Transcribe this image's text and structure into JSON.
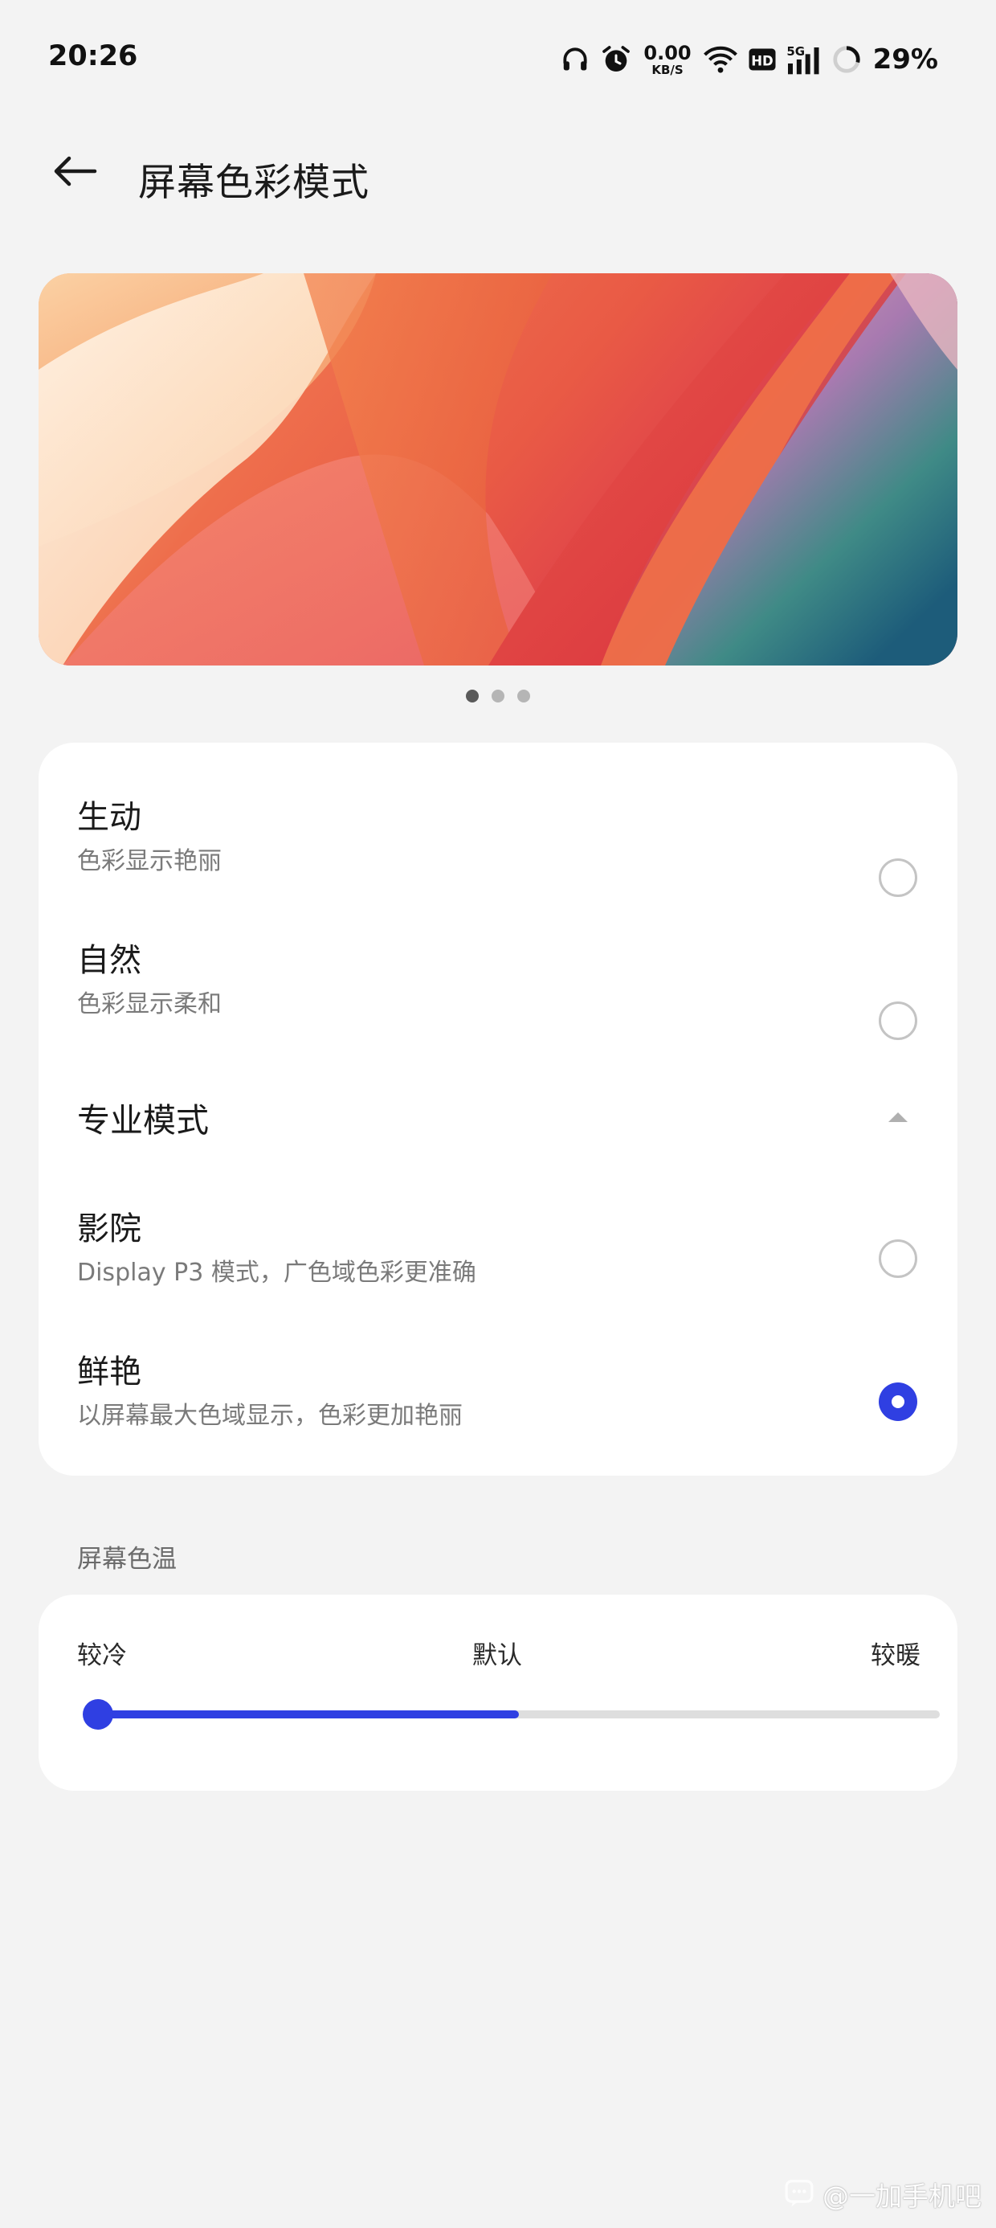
{
  "status_bar": {
    "time": "20:26",
    "net_speed_value": "0.00",
    "net_speed_unit": "KB/S",
    "battery_percent": "29%",
    "battery_level": 0.29,
    "icons": [
      "headphones-icon",
      "alarm-icon",
      "net-speed-icon",
      "wifi-icon",
      "hd-icon",
      "signal-5g-icon",
      "battery-ring-icon"
    ]
  },
  "header": {
    "back_icon": "back-arrow-icon",
    "title": "屏幕色彩模式"
  },
  "preview": {
    "page_count": 3,
    "active_index": 0
  },
  "color_modes": {
    "options": [
      {
        "title": "生动",
        "subtitle": "色彩显示艳丽",
        "selected": false
      },
      {
        "title": "自然",
        "subtitle": "色彩显示柔和",
        "selected": false
      }
    ],
    "pro_section": {
      "title": "专业模式",
      "expanded": true,
      "options": [
        {
          "title": "影院",
          "subtitle": "Display P3 模式，广色域色彩更准确",
          "selected": false
        },
        {
          "title": "鲜艳",
          "subtitle": "以屏幕最大色域显示，色彩更加艳丽",
          "selected": true
        }
      ]
    }
  },
  "color_temperature": {
    "section_label": "屏幕色温",
    "left_label": "较冷",
    "center_label": "默认",
    "right_label": "较暖",
    "value": 0.0,
    "default_value": 0.5
  },
  "watermark": {
    "text": "@一加手机吧"
  },
  "colors": {
    "accent": "#2f3fe2",
    "background": "#f3f3f3",
    "card": "#ffffff"
  }
}
